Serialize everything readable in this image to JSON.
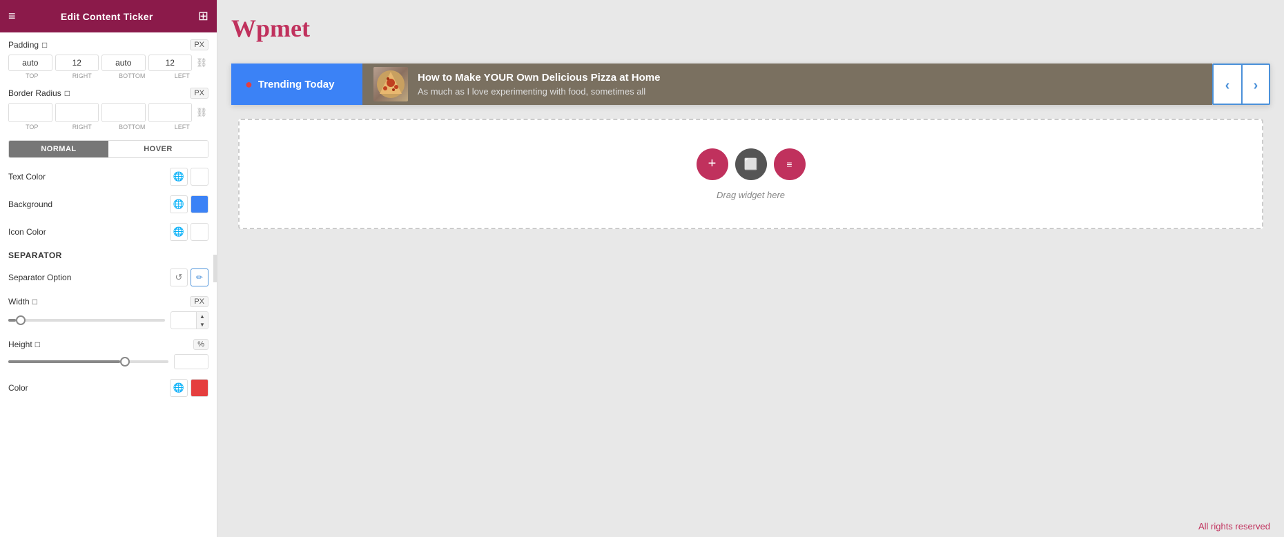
{
  "header": {
    "title": "Edit Content Ticker",
    "menu_icon": "≡",
    "grid_icon": "⊞"
  },
  "panel": {
    "padding": {
      "label": "Padding",
      "unit": "PX",
      "values": {
        "top": "auto",
        "right": "12",
        "bottom": "auto",
        "left": "12"
      },
      "sublabels": [
        "TOP",
        "RIGHT",
        "BOTTOM",
        "LEFT"
      ]
    },
    "border_radius": {
      "label": "Border Radius",
      "unit": "PX",
      "values": [
        "",
        "",
        "",
        ""
      ]
    },
    "tabs": {
      "normal": "NORMAL",
      "hover": "HOVER"
    },
    "text_color": {
      "label": "Text Color"
    },
    "background": {
      "label": "Background",
      "color": "#3b82f6"
    },
    "icon_color": {
      "label": "Icon Color"
    },
    "separator": {
      "section_title": "Separator",
      "option_label": "Separator Option"
    },
    "width": {
      "label": "Width",
      "unit": "PX",
      "value": "5"
    },
    "height": {
      "label": "Height",
      "unit": "%",
      "value": "70"
    },
    "color": {
      "label": "Color",
      "color": "#e53e3e"
    },
    "collapse_arrow": "‹"
  },
  "canvas": {
    "logo": "Wpmet",
    "ticker": {
      "label_text": "Trending Today",
      "title": "How to Make YOUR Own Delicious Pizza at Home",
      "description": "As much as I love experimenting with food, sometimes all",
      "arrow_left": "‹",
      "arrow_right": "›"
    },
    "drop_zone": {
      "text": "Drag widget here",
      "buttons": [
        "+",
        "□",
        "≡"
      ]
    },
    "footer": "All rights reserved"
  }
}
